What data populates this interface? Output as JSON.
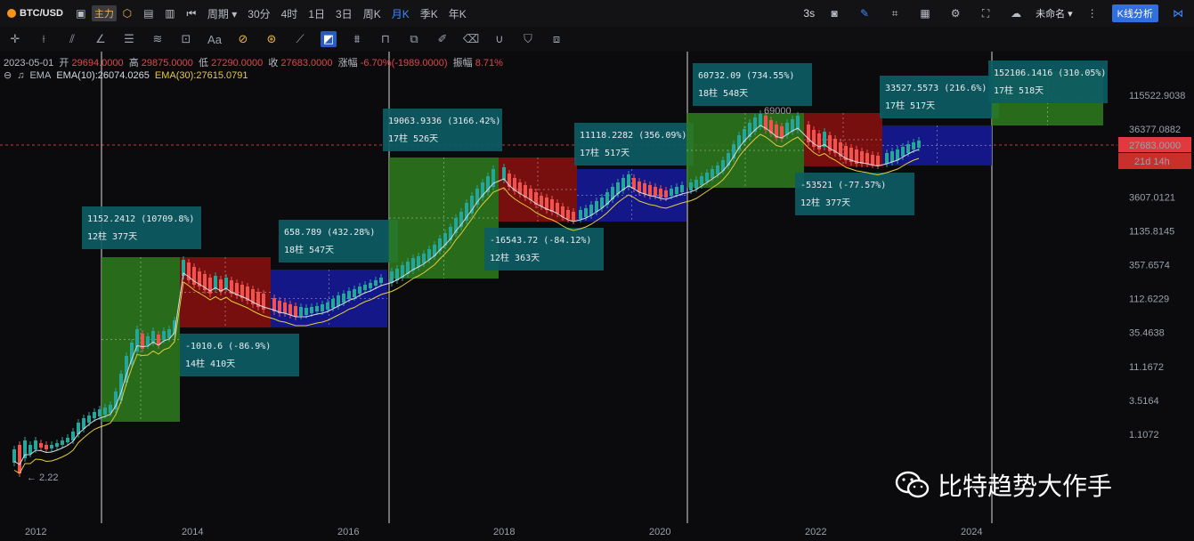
{
  "toolbar": {
    "symbol": "BTC/USD",
    "main_label": "主力",
    "period_label": "周期",
    "intervals": [
      "30分",
      "4时",
      "1日",
      "3日",
      "周K",
      "月K",
      "季K",
      "年K"
    ],
    "active_interval": "月K",
    "refresh": "3s",
    "layout_name": "未命名",
    "analysis_btn": "K线分析"
  },
  "ohlc": {
    "date": "2023-05-01",
    "open_label": "开",
    "open": "29694.0000",
    "high_label": "高",
    "high": "29875.0000",
    "low_label": "低",
    "low": "27290.0000",
    "close_label": "收",
    "close": "27683.0000",
    "change_label": "涨幅",
    "change": "-6.70%(-1989.0000)",
    "amp_label": "振幅",
    "amp": "8.71%"
  },
  "ema": {
    "label": "EMA",
    "ema10": "EMA(10):26074.0265",
    "ema30": "EMA(30):27615.0791"
  },
  "price_tag": {
    "value": "27683.0000",
    "countdown": "21d 14h"
  },
  "watermark": "比特趋势大作手",
  "colors": {
    "up": "#26a69a",
    "down": "#ef5350",
    "green_box": "#2e7d1e",
    "red_box": "#8b1010",
    "blue_box": "#151a9e",
    "label_bg": "#0d5c63",
    "ema10": "#d8dbe0",
    "ema30": "#e5cc3c"
  },
  "chart_data": {
    "type": "candlestick",
    "y_scale": "log",
    "y_ticks": [
      "115522.9038",
      "36377.0882",
      "11454.8068",
      "3607.0121",
      "1135.8145",
      "357.6574",
      "112.6229",
      "35.4638",
      "11.1672",
      "3.5164",
      "1.1072"
    ],
    "x_ticks": [
      "2012",
      "2014",
      "2016",
      "2018",
      "2020",
      "2022",
      "2024"
    ],
    "annotations": {
      "low_label": "2.22",
      "high_label": "69000"
    },
    "cycle_boxes": [
      {
        "kind": "green",
        "text1": "1152.2412 (10709.8%)",
        "text2": "12柱 377天"
      },
      {
        "kind": "red",
        "text1": "-1010.6 (-86.9%)",
        "text2": "14柱 410天"
      },
      {
        "kind": "blue",
        "text1": "658.789 (432.28%)",
        "text2": "18柱 547天"
      },
      {
        "kind": "green",
        "text1": "19063.9336 (3166.42%)",
        "text2": "17柱 526天"
      },
      {
        "kind": "red",
        "text1": "-16543.72 (-84.12%)",
        "text2": "12柱 363天"
      },
      {
        "kind": "blue",
        "text1": "11118.2282 (356.09%)",
        "text2": "17柱 517天"
      },
      {
        "kind": "green",
        "text1": "60732.09 (734.55%)",
        "text2": "18柱 548天"
      },
      {
        "kind": "red",
        "text1": "-53521 (-77.57%)",
        "text2": "12柱 377天"
      },
      {
        "kind": "blue",
        "text1": "33527.5573 (216.6%)",
        "text2": "17柱 517天"
      },
      {
        "kind": "green",
        "text1": "152106.1416 (310.05%)",
        "text2": "17柱 518天"
      }
    ]
  }
}
